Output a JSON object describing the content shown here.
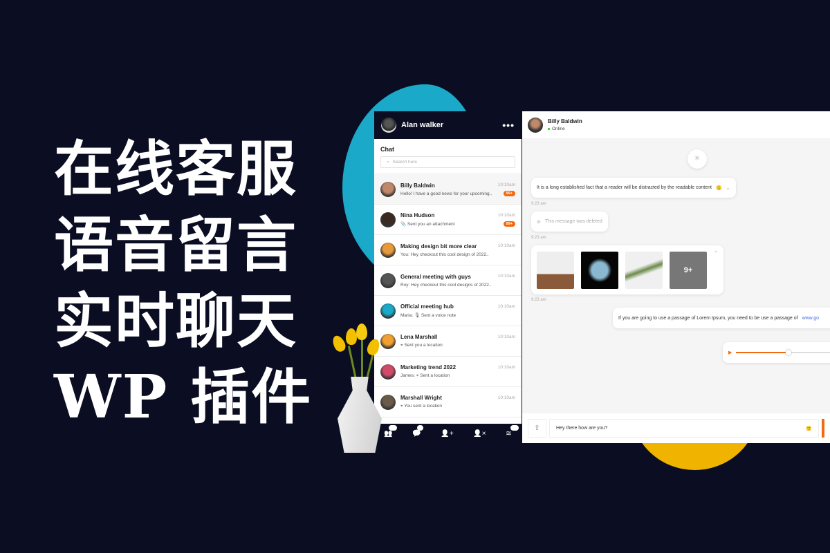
{
  "headline": [
    "在线客服",
    "语音留言",
    "实时聊天",
    "WP 插件"
  ],
  "sidebar": {
    "user": "Alan walker",
    "menu_icon": "more-horizontal-icon",
    "section": "Chat",
    "search_placeholder": "Search here",
    "chats": [
      {
        "name": "Billy Baldwin",
        "msg": "Hello! I have a good news for your upcoming..",
        "time": "10:10am",
        "badge": "99+",
        "color": "#c08a6a"
      },
      {
        "name": "Nina Hudson",
        "msg": "📎 Sent you an attachment",
        "time": "10:10am",
        "badge": "99+",
        "color": "#3a2a22"
      },
      {
        "name": "Making design bit more clear",
        "msg": "You: Hey checkout this cool design of 2022..",
        "time": "10:10am",
        "color": "#e79a3a"
      },
      {
        "name": "General meeting with guys",
        "msg": "Roy: Hey checkout this cool designs of 2022..",
        "time": "10:10am",
        "color": "#555"
      },
      {
        "name": "Official meeting hub",
        "msg": "Maria: 🎙 Sent a voice note",
        "time": "10:10am",
        "color": "#1aa9c9"
      },
      {
        "name": "Lena Marshall",
        "msg": "⌖ Sent you a location",
        "time": "10:10am",
        "color": "#f0a030"
      },
      {
        "name": "Marketing trend 2022",
        "msg": "James: ⌖ Sent a location",
        "time": "10:10am",
        "color": "#d04a6a"
      },
      {
        "name": "Marshall Wright",
        "msg": "⌖ You sent a location",
        "time": "10:10am",
        "color": "#6a5a4a"
      }
    ],
    "nav": [
      {
        "icon": "users-icon",
        "badge": "24"
      },
      {
        "icon": "chat-icon",
        "badge": "2"
      },
      {
        "icon": "add-user-icon"
      },
      {
        "icon": "remove-user-icon"
      },
      {
        "icon": "stack-icon",
        "badge": "11"
      }
    ]
  },
  "conversation": {
    "name": "Billy Baldwin",
    "status": "Online",
    "msg1": "It is a long established fact that a reader will be distracted by the readable content",
    "time": "9:23 am",
    "deleted": "This message was deleted",
    "more_images": "9+",
    "msg2": "If you are going to use a passage of Lorem Ipsum, you need to be use a passage of",
    "link": "www.go",
    "audio_progress": 0.5,
    "input_value": "Hey there how are you?"
  },
  "colors": {
    "accent": "#f26a10",
    "dark": "#0b0e22",
    "cyan": "#1aa9c9",
    "yellow": "#f0b400"
  }
}
